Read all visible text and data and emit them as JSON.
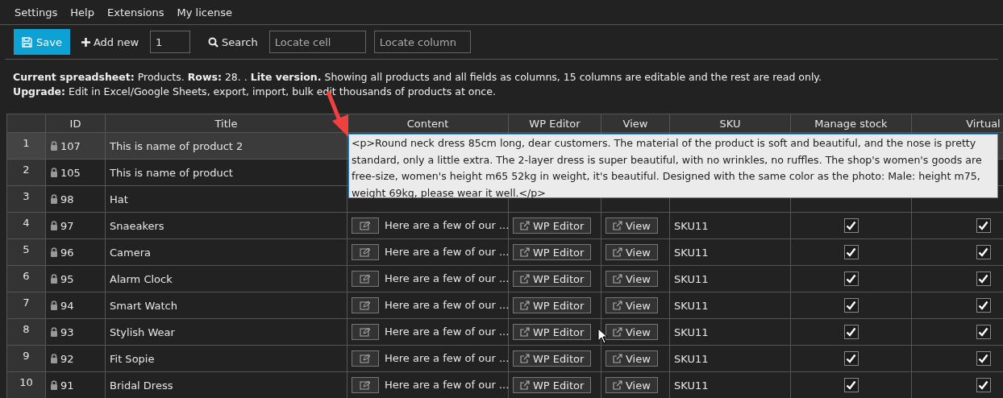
{
  "menu": [
    {
      "label": "Settings"
    },
    {
      "label": "Help"
    },
    {
      "label": "Extensions"
    },
    {
      "label": "My license"
    }
  ],
  "toolbar": {
    "save": "Save",
    "add_new": "Add new",
    "add_count": "1",
    "search": "Search",
    "locate_cell": {
      "placeholder": "Locate cell"
    },
    "locate_column": {
      "placeholder": "Locate column"
    }
  },
  "info": [
    "**Current spreadsheet:** Products. **Rows:** 28. . **Lite version.** Showing all products and all fields as columns, 15 columns are editable and the rest are read only.",
    "**Upgrade:** Edit in Excel/Google Sheets, export, import, bulk edit thousands of products at once."
  ],
  "table": {
    "columns": [
      "ID",
      "Title",
      "Content",
      "WP Editor",
      "View",
      "SKU",
      "Manage stock",
      "Virtual"
    ],
    "rows": [
      {
        "number": "1",
        "id": "107",
        "title": "This is name of product 2",
        "selected": true
      },
      {
        "number": "2",
        "id": "105",
        "title": "This is name of product",
        "selected": false
      },
      {
        "number": "3",
        "id": "98",
        "title": "Hat",
        "selected": false
      },
      {
        "number": "4",
        "id": "97",
        "title": "Snaeakers",
        "selected": false,
        "content": "Here are a few of our ...",
        "wp_editor": "WP Editor",
        "view": "View",
        "sku": "SKU11",
        "manage_stock": true,
        "virtual": true
      },
      {
        "number": "5",
        "id": "96",
        "title": "Camera",
        "selected": false,
        "content": "Here are a few of our ...",
        "wp_editor": "WP Editor",
        "view": "View",
        "sku": "SKU11",
        "manage_stock": true,
        "virtual": true
      },
      {
        "number": "6",
        "id": "95",
        "title": "Alarm Clock",
        "selected": false,
        "content": "Here are a few of our ...",
        "wp_editor": "WP Editor",
        "view": "View",
        "sku": "SKU11",
        "manage_stock": true,
        "virtual": true
      },
      {
        "number": "7",
        "id": "94",
        "title": "Smart Watch",
        "selected": false,
        "content": "Here are a few of our ...",
        "wp_editor": "WP Editor",
        "view": "View",
        "sku": "SKU11",
        "manage_stock": true,
        "virtual": true
      },
      {
        "number": "8",
        "id": "93",
        "title": "Stylish Wear",
        "selected": false,
        "content": "Here are a few of our ...",
        "wp_editor": "WP Editor",
        "view": "View",
        "sku": "SKU11",
        "manage_stock": true,
        "virtual": true
      },
      {
        "number": "9",
        "id": "92",
        "title": "Fit Sopie",
        "selected": false,
        "content": "Here are a few of our ...",
        "wp_editor": "WP Editor",
        "view": "View",
        "sku": "SKU11",
        "manage_stock": true,
        "virtual": true
      },
      {
        "number": "10",
        "id": "91",
        "title": "Bridal Dress",
        "selected": false,
        "content": "Here are a few of our ...",
        "wp_editor": "WP Editor",
        "view": "View",
        "sku": "SKU11",
        "manage_stock": true,
        "virtual": true
      }
    ]
  },
  "editor": {
    "value": "<p>Round neck dress 85cm long, dear customers. The material of the product is soft and beautiful, and the nose is pretty standard, only a little extra. The 2-layer dress is super beautiful, with no wrinkles, no ruffles. The shop's women's goods are free-size, women's height m65 52kg in weight, it's beautiful. Designed with the same color as the photo: Male: height m75, weight 69kg, please wear it well.</p>"
  }
}
